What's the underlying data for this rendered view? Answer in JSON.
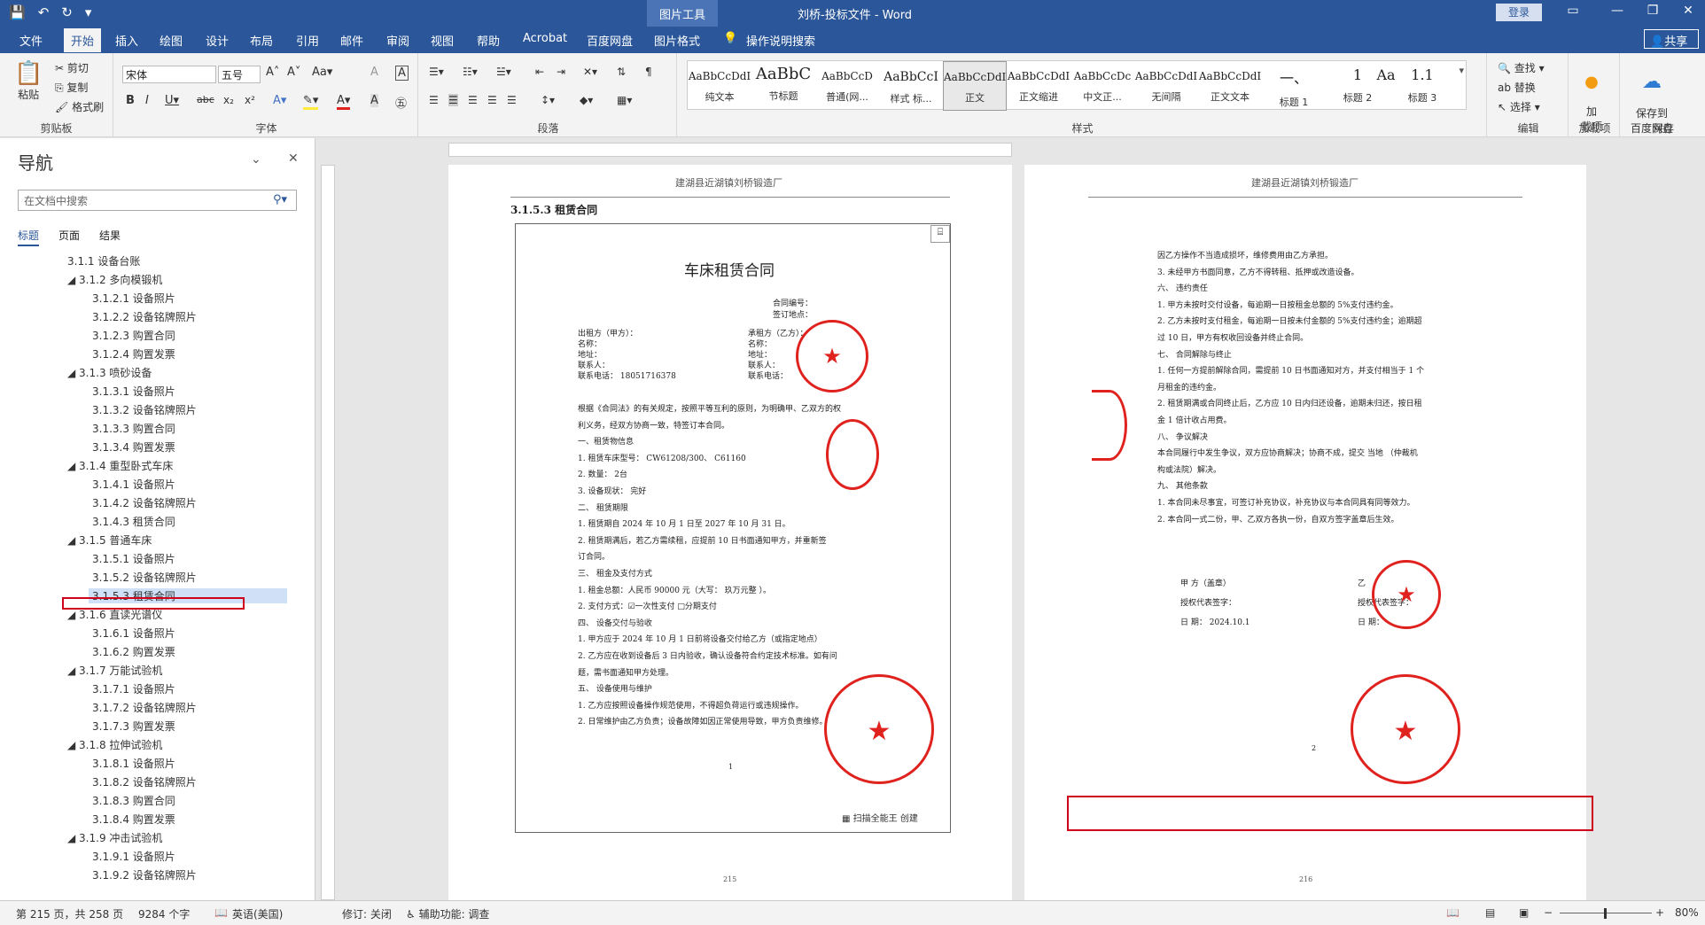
{
  "app": {
    "context_tab": "图片工具",
    "title": "刘桥-投标文件 - Word",
    "login": "登录",
    "share": "共享"
  },
  "tabs": [
    "文件",
    "开始",
    "插入",
    "绘图",
    "设计",
    "布局",
    "引用",
    "邮件",
    "审阅",
    "视图",
    "帮助",
    "Acrobat",
    "百度网盘",
    "图片格式"
  ],
  "tell_me": "操作说明搜索",
  "ribbon": {
    "clipboard": {
      "paste": "粘贴",
      "cut": "剪切",
      "copy": "复制",
      "format_painter": "格式刷",
      "label": "剪贴板"
    },
    "font": {
      "name": "宋体",
      "size": "五号",
      "label": "字体"
    },
    "paragraph": {
      "label": "段落"
    },
    "styles": {
      "label": "样式",
      "items": [
        {
          "sample": "AaBbCcDdI",
          "name": "纯文本"
        },
        {
          "sample": "AaBbC",
          "name": "节标题"
        },
        {
          "sample": "AaBbCcD",
          "name": "普通(网..."
        },
        {
          "sample": "AaBbCcI",
          "name": "样式 标..."
        },
        {
          "sample": "AaBbCcDdI",
          "name": "正文"
        },
        {
          "sample": "AaBbCcDdI",
          "name": "正文缩进"
        },
        {
          "sample": "AaBbCcDc",
          "name": "中文正..."
        },
        {
          "sample": "AaBbCcDdI",
          "name": "无间隔"
        },
        {
          "sample": "AaBbCcDdI",
          "name": "正文文本"
        },
        {
          "sample": "一、",
          "name": "标题 1"
        },
        {
          "sample": "1",
          "name": "标题 2"
        },
        {
          "sample": "Aa",
          "name": ""
        },
        {
          "sample": "1.1",
          "name": "标题 3"
        }
      ]
    },
    "editing": {
      "find": "查找",
      "replace": "替换",
      "select": "选择",
      "label": "编辑"
    },
    "addins": {
      "load": "加\n载项",
      "label": "加载项"
    },
    "baidu": {
      "save": "保存到\n百度网盘",
      "label": "保存"
    }
  },
  "nav": {
    "title": "导航",
    "search_placeholder": "在文档中搜索",
    "tabs": [
      "标题",
      "页面",
      "结果"
    ],
    "items": [
      {
        "text": "3.1.1 设备台账",
        "level": 1
      },
      {
        "text": "◢ 3.1.2 多向模锻机",
        "level": 1
      },
      {
        "text": "3.1.2.1 设备照片",
        "level": 2
      },
      {
        "text": "3.1.2.2 设备铭牌照片",
        "level": 2
      },
      {
        "text": "3.1.2.3 购置合同",
        "level": 2
      },
      {
        "text": "3.1.2.4 购置发票",
        "level": 2
      },
      {
        "text": "◢ 3.1.3 喷砂设备",
        "level": 1
      },
      {
        "text": "3.1.3.1 设备照片",
        "level": 2
      },
      {
        "text": "3.1.3.2 设备铭牌照片",
        "level": 2
      },
      {
        "text": "3.1.3.3 购置合同",
        "level": 2
      },
      {
        "text": "3.1.3.4 购置发票",
        "level": 2
      },
      {
        "text": "◢ 3.1.4 重型卧式车床",
        "level": 1
      },
      {
        "text": "3.1.4.1 设备照片",
        "level": 2
      },
      {
        "text": "3.1.4.2 设备铭牌照片",
        "level": 2
      },
      {
        "text": "3.1.4.3 租赁合同",
        "level": 2
      },
      {
        "text": "◢ 3.1.5 普通车床",
        "level": 1
      },
      {
        "text": "3.1.5.1 设备照片",
        "level": 2
      },
      {
        "text": "3.1.5.2 设备铭牌照片",
        "level": 2
      },
      {
        "text": "3.1.5.3 租赁合同",
        "level": 2
      },
      {
        "text": "◢ 3.1.6 直读光谱仪",
        "level": 1
      },
      {
        "text": "3.1.6.1 设备照片",
        "level": 2
      },
      {
        "text": "3.1.6.2 购置发票",
        "level": 2
      },
      {
        "text": "◢ 3.1.7 万能试验机",
        "level": 1
      },
      {
        "text": "3.1.7.1 设备照片",
        "level": 2
      },
      {
        "text": "3.1.7.2 设备铭牌照片",
        "level": 2
      },
      {
        "text": "3.1.7.3 购置发票",
        "level": 2
      },
      {
        "text": "◢ 3.1.8 拉伸试验机",
        "level": 1
      },
      {
        "text": "3.1.8.1 设备照片",
        "level": 2
      },
      {
        "text": "3.1.8.2 设备铭牌照片",
        "level": 2
      },
      {
        "text": "3.1.8.3 购置合同",
        "level": 2
      },
      {
        "text": "3.1.8.4 购置发票",
        "level": 2
      },
      {
        "text": "◢ 3.1.9 冲击试验机",
        "level": 1
      },
      {
        "text": "3.1.9.1 设备照片",
        "level": 2
      },
      {
        "text": "3.1.9.2 设备铭牌照片",
        "level": 2
      }
    ]
  },
  "page215": {
    "header": "建湖县近湖镇刘桥锻造厂",
    "heading": "3.1.5.3  租赁合同",
    "contract_title": "车床租赁合同",
    "contract_no": "合同编号：",
    "sign_place": "签订地点：",
    "party_a": [
      "出租方（甲方）：",
      "名称：",
      "地址：",
      "联系人：",
      "联系电话：  18051716378"
    ],
    "party_b": [
      "承租方（乙方）：",
      "名称：",
      "地址：",
      "联系人：",
      "联系电话："
    ],
    "body": [
      "根据《合同法》的有关规定，按照平等互利的原则，为明确甲、乙双方的权",
      "利义务，经双方协商一致，特签订本合同。",
      "一、租赁物信息",
      "1. 租赁车床型号：  CW61208/300、 C61160",
      "2. 数量：            2台",
      "3. 设备现状：      完好",
      "二、   租赁期限",
      "1. 租赁期自 2024 年 10 月 1 日至 2027 年 10 月 31 日。",
      "2. 租赁期满后，若乙方需续租，应提前  10  日书面通知甲方，并重新签",
      "订合同。",
      "三、   租金及支付方式",
      "1. 租金总额：人民币  90000  元（大写：  玖万元整   ）。",
      "2. 支付方式：☑一次性支付  □分期支付",
      "四、 设备交付与验收",
      "1. 甲方应于 2024 年 10 月 1 日前将设备交付给乙方（或指定地点）",
      "2. 乙方应在收到设备后 3 日内验收，确认设备符合约定技术标准。如有问",
      "题，需书面通知甲方处理。",
      "五、 设备使用与维护",
      "1. 乙方应按照设备操作规范使用，不得超负荷运行或违规操作。",
      "2. 日常维护由乙方负责；设备故障如因正常使用导致，甲方负责维修。"
    ],
    "scan_watermark": "扫描全能王 创建",
    "page_inner": "1",
    "footer": "215"
  },
  "page216": {
    "header": "建湖县近湖镇刘桥锻造厂",
    "body": [
      "因乙方操作不当造成损坏，维修费用由乙方承担。",
      "3. 未经甲方书面同意，乙方不得转租、抵押或改造设备。",
      "六、 违约责任",
      "1. 甲方未按时交付设备，每逾期一日按租金总额的 5%支付违约金。",
      "2. 乙方未按时支付租金，每逾期一日按未付金额的 5%支付违约金；逾期超",
      "过 10 日，甲方有权收回设备并终止合同。",
      "七、 合同解除与终止",
      "1. 任何一方提前解除合同，需提前 10 日书面通知对方，并支付相当于 1 个",
      "月租金的违约金。",
      "2. 租赁期满或合同终止后，乙方应 10 日内归还设备，逾期未归还，按日租",
      "金 1 倍计收占用费。",
      "八、 争议解决",
      "本合同履行中发生争议，双方应协商解决；协商不成，提交  当地  （仲裁机",
      "构或法院）解决。",
      "九、 其他条款",
      "1. 本合同未尽事宜，可签订补充协议，补充协议与本合同具有同等效力。",
      "2. 本合同一式二份，甲、乙双方各执一份，自双方签字盖章后生效。"
    ],
    "sign": [
      "甲 方（盖章）",
      "授权代表签字：",
      "日  期：  2024.10.1",
      "乙",
      "授权代表签字：",
      "日  期："
    ],
    "page_inner": "2",
    "footer": "216"
  },
  "status": {
    "page": "第 215 页，共 258 页",
    "words": "9284 个字",
    "lang": "英语(美国)",
    "track": "修订: 关闭",
    "access": "辅助功能: 调查",
    "zoom": "80%"
  }
}
